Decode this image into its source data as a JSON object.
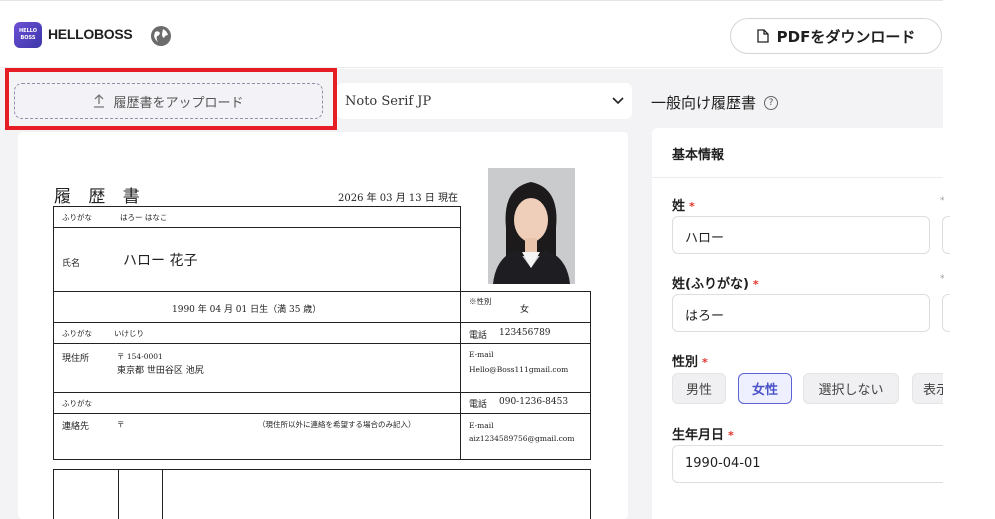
{
  "header": {
    "logo_text": "HELLO BOSS",
    "brand": "HELLOBOSS",
    "language_icon": "globe-icon",
    "pdf_button_label": "PDFをダウンロード"
  },
  "toolbar": {
    "upload_label": "履歴書をアップロード",
    "font_value": "Noto Serif JP"
  },
  "resume": {
    "title": "履 歴 書",
    "date": "2026 年 03 月 13 日 現在",
    "furigana_label": "ふりがな",
    "furigana_value": "はろー はなこ",
    "name_label": "氏名",
    "name_value": "ハロー 花子",
    "birth": "1990  年   04   月  01  日生（満 35 歳）",
    "gender_label": "※性別",
    "gender_value": "女",
    "addr_furigana_label": "ふりがな",
    "addr_furigana_value": "いけじり",
    "phone_label": "電話",
    "phone_value": "123456789",
    "address_label": "現住所",
    "postal": "〒 154-0001",
    "address": "東京都 世田谷区 池尻",
    "email_label": "E-mail",
    "email_value": "Hello@Boss111gmail.com",
    "contact_furigana_label": "ふりがな",
    "contact_phone_label": "電話",
    "contact_phone_value": "090-1236-8453",
    "contact_label": "連絡先",
    "contact_postal": "〒",
    "contact_note": "（現住所以外に連絡を希望する場合のみ記入）",
    "contact_email_label": "E-mail",
    "contact_email_value": "aiz1234589756@gmail.com"
  },
  "panel": {
    "title": "一般向け履歴書",
    "section_title": "基本情報",
    "last_name_label": "姓",
    "last_name_value": "ハロー",
    "last_name_kana_label": "姓(ふりがな)",
    "last_name_kana_value": "はろー",
    "gender_label": "性別",
    "gender_options": [
      "男性",
      "女性",
      "選択しない",
      "表示"
    ],
    "gender_selected": "女性",
    "birthday_label": "生年月日",
    "birthday_value": "1990-04-01",
    "required_mark": "*"
  }
}
